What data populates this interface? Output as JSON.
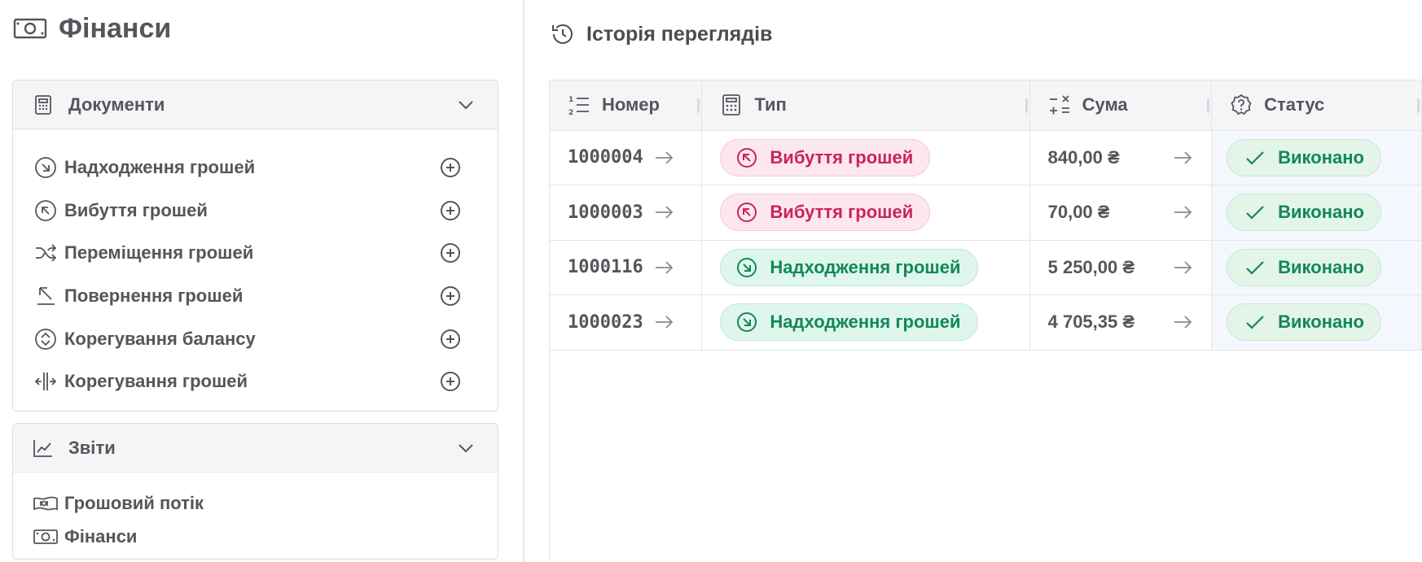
{
  "app": {
    "title": "Фінанси",
    "icon": "banknote-icon"
  },
  "documents": {
    "title": "Документи",
    "icon": "calculator-icon",
    "items": [
      {
        "label": "Надходження грошей",
        "icon": "arrow-down-right-circle-icon"
      },
      {
        "label": "Вибуття грошей",
        "icon": "arrow-up-left-circle-icon"
      },
      {
        "label": "Переміщення грошей",
        "icon": "shuffle-icon"
      },
      {
        "label": "Повернення грошей",
        "icon": "return-arrow-icon"
      },
      {
        "label": "Корегування балансу",
        "icon": "chevrons-up-down-circle-icon"
      },
      {
        "label": "Корегування грошей",
        "icon": "split-arrows-icon"
      }
    ]
  },
  "reports": {
    "title": "Звіти",
    "icon": "trend-chart-icon",
    "items": [
      {
        "label": "Грошовий потік",
        "icon": "cash-flow-icon"
      },
      {
        "label": "Фінанси",
        "icon": "banknote-icon"
      }
    ]
  },
  "history": {
    "title": "Історія переглядів",
    "icon": "history-icon",
    "columns": [
      {
        "label": "Номер",
        "icon": "list-ordered-icon"
      },
      {
        "label": "Тип",
        "icon": "calculator-icon"
      },
      {
        "label": "Сума",
        "icon": "math-operations-icon"
      },
      {
        "label": "Статус",
        "icon": "badge-question-icon"
      }
    ],
    "rows": [
      {
        "number": "1000004",
        "type": "Вибуття грошей",
        "kind": "out",
        "sum": "840,00 ₴",
        "status": "Виконано"
      },
      {
        "number": "1000003",
        "type": "Вибуття грошей",
        "kind": "out",
        "sum": "70,00 ₴",
        "status": "Виконано"
      },
      {
        "number": "1000116",
        "type": "Надходження грошей",
        "kind": "in",
        "sum": "5 250,00 ₴",
        "status": "Виконано"
      },
      {
        "number": "1000023",
        "type": "Надходження грошей",
        "kind": "in",
        "sum": "4 705,35 ₴",
        "status": "Виконано"
      }
    ]
  },
  "colors": {
    "out": "#c8245b",
    "in": "#12875a",
    "done": "#12875a",
    "text": "#55555c",
    "divider": "#dde7f5"
  }
}
